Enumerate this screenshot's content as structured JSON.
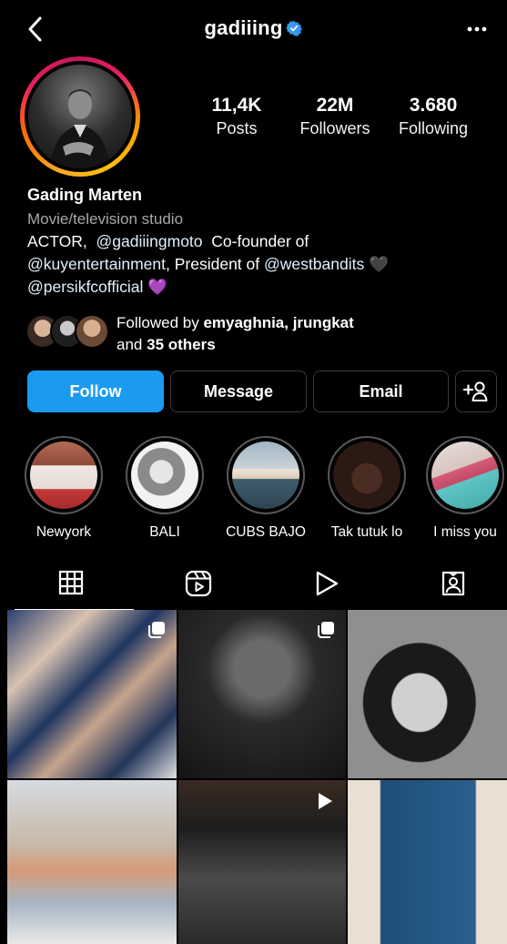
{
  "header": {
    "username": "gadiiing",
    "back_icon": "chevron-left-icon",
    "verified_icon": "verified-badge-icon",
    "more_icon": "more-dots-icon",
    "verified_color": "#3897f0"
  },
  "stats": {
    "posts": {
      "value": "11,4K",
      "label": "Posts"
    },
    "followers": {
      "value": "22M",
      "label": "Followers"
    },
    "following": {
      "value": "3.680",
      "label": "Following"
    }
  },
  "bio": {
    "name": "Gading Marten",
    "category": "Movie/television studio",
    "line1_prefix": "ACTOR,",
    "line1_mention": "@gadiiingmoto",
    "line1_suffix": "Co-founder of",
    "line2_mention1": "@kuyentertainment",
    "line2_mid": ", President of",
    "line2_mention2": "@westbandits",
    "line2_emoji": "🖤",
    "line3_mention": "@persikfcofficial",
    "line3_emoji": "💜"
  },
  "followed_by": {
    "prefix": "Followed by",
    "names": "emyaghnia, jrungkat",
    "and": "and",
    "others": "35 others"
  },
  "actions": {
    "follow": "Follow",
    "message": "Message",
    "email": "Email",
    "add_person_icon": "add-person-icon",
    "accent": "#1a9bf0"
  },
  "highlights": [
    {
      "label": "Newyork"
    },
    {
      "label": "BALI"
    },
    {
      "label": "CUBS BAJO"
    },
    {
      "label": "Tak tutuk lo"
    },
    {
      "label": "I miss you"
    }
  ],
  "tabs": [
    {
      "icon": "grid-icon",
      "active": true
    },
    {
      "icon": "reels-icon",
      "active": false
    },
    {
      "icon": "play-icon",
      "active": false
    },
    {
      "icon": "tagged-icon",
      "active": false
    }
  ]
}
